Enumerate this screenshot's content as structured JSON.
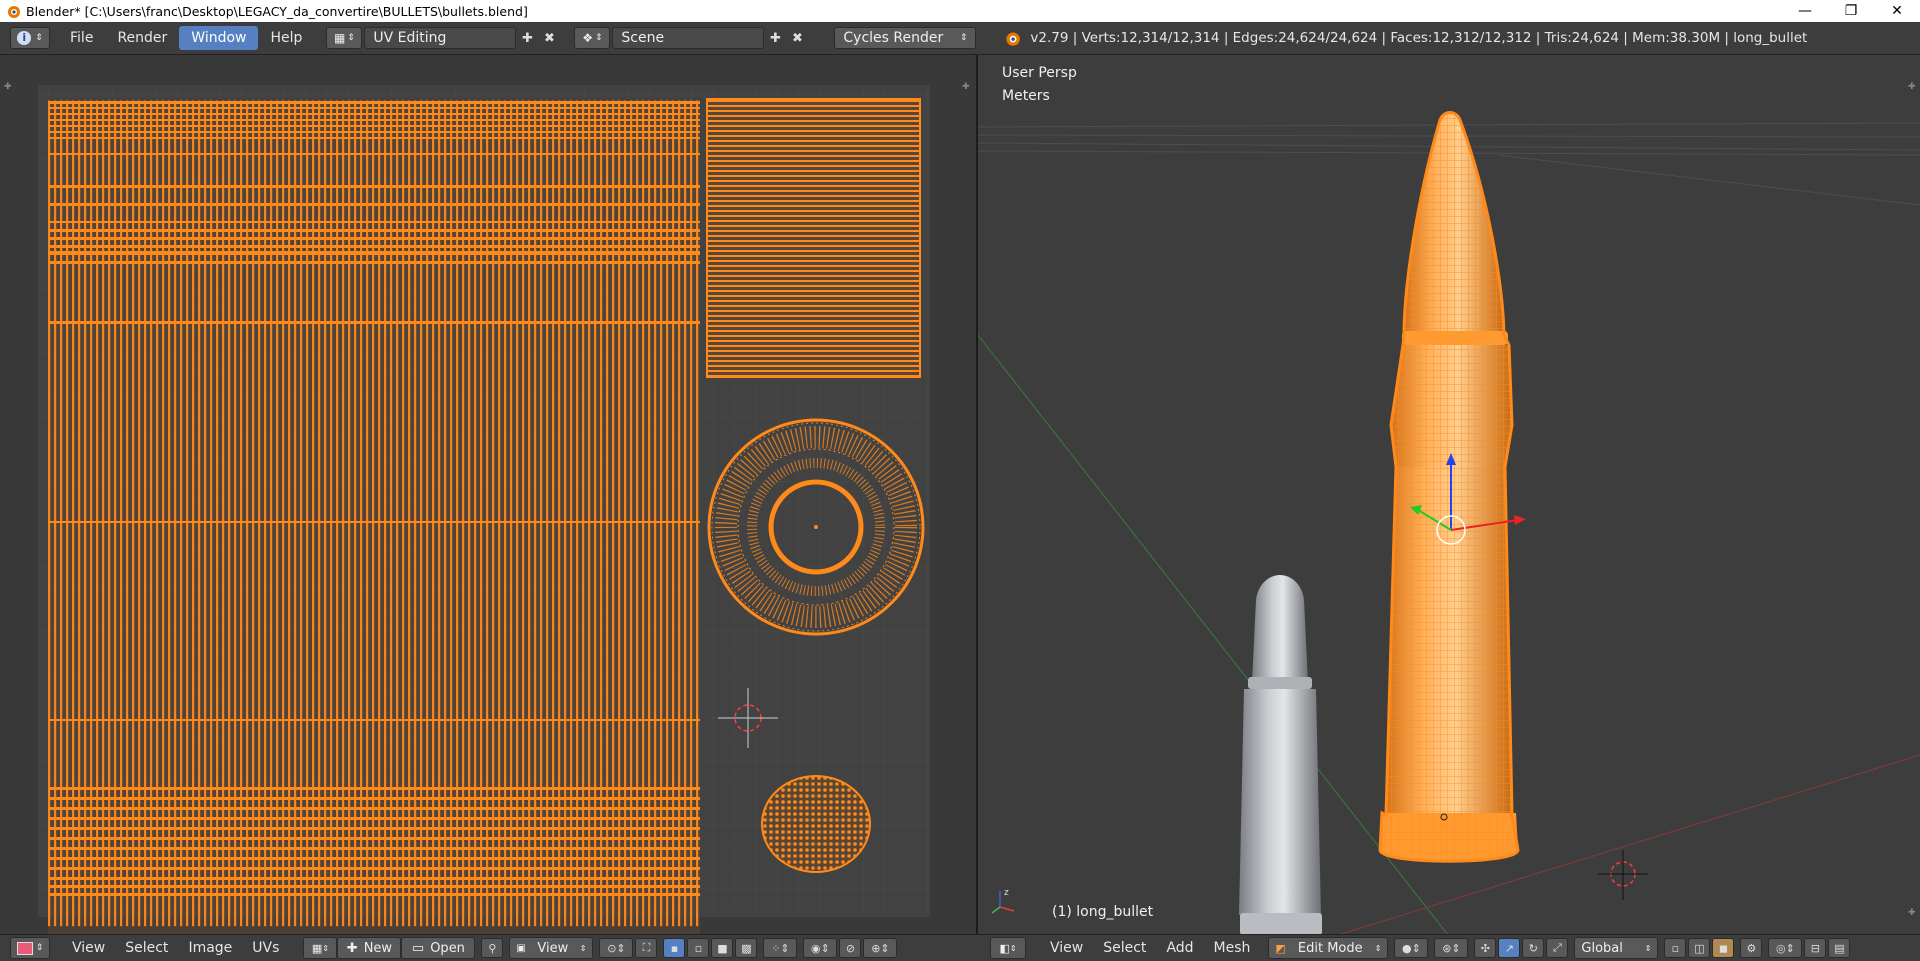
{
  "window": {
    "title": "Blender* [C:\\Users\\franc\\Desktop\\LEGACY_da_convertire\\BULLETS\\bullets.blend]",
    "minimize": "—",
    "restore": "❐",
    "close": "✕"
  },
  "menubar": {
    "info_icon": "info-icon",
    "menus": [
      "File",
      "Render",
      "Window",
      "Help"
    ],
    "active_menu": "Window",
    "layout": "UV Editing",
    "scene": "Scene",
    "engine": "Cycles Render",
    "stats": "v2.79 | Verts:12,314/12,314 | Edges:24,624/24,624 | Faces:12,312/12,312 | Tris:24,624 | Mem:38.30M | long_bullet"
  },
  "uv_editor": {
    "grid_color": "#4a4a4a",
    "uv_color": "#ff8a1a"
  },
  "viewport": {
    "view_label": "User Persp",
    "units_label": "Meters",
    "object_label": "(1) long_bullet",
    "selected_color": "#ff8a1a"
  },
  "uv_header": {
    "menus": [
      "View",
      "Select",
      "Image",
      "UVs"
    ],
    "new_label": "New",
    "open_label": "Open",
    "view_dropdown": "View"
  },
  "vp_header": {
    "menus": [
      "View",
      "Select",
      "Add",
      "Mesh"
    ],
    "mode": "Edit Mode",
    "orientation": "Global"
  },
  "colors": {
    "accent": "#5680c2",
    "panel": "#3d3d3d",
    "orange": "#ff8a1a"
  }
}
